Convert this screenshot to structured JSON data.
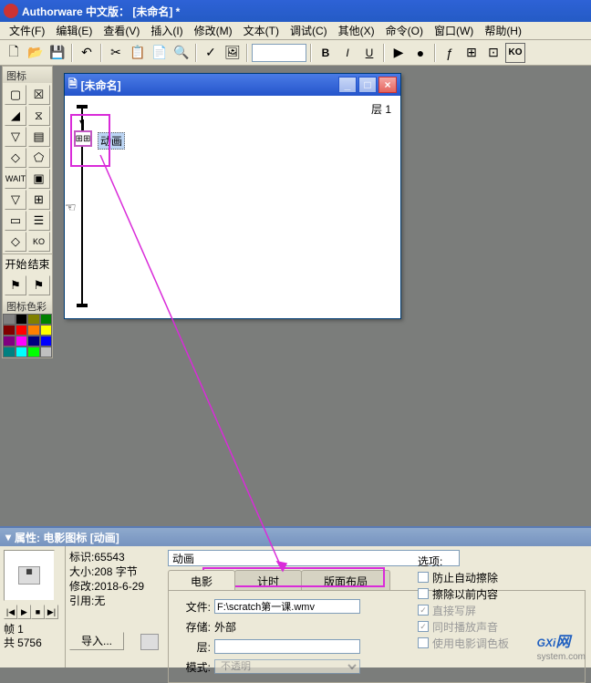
{
  "title": "Authorware 中文版： [未命名] *",
  "menus": [
    "文件(F)",
    "编辑(E)",
    "查看(V)",
    "插入(I)",
    "修改(M)",
    "文本(T)",
    "调试(C)",
    "其他(X)",
    "命令(O)",
    "窗口(W)",
    "帮助(H)"
  ],
  "palette": {
    "title": "图标",
    "section1": "开始",
    "section2": "结束",
    "colors_title": "图标色彩"
  },
  "flowwin": {
    "title": "[未命名]",
    "layer": "层 1",
    "movie_label": "动画"
  },
  "props": {
    "title": "属性: 电影图标 [动画]",
    "meta": {
      "id_label": "标识:",
      "id": "65543",
      "size_label": "大小:",
      "size": "208 字节",
      "mod_label": "修改:",
      "mod": "2018-6-29",
      "ref_label": "引用:",
      "ref": "无"
    },
    "frame": {
      "l1_label": "帧",
      "l1_val": "1",
      "l2_label": "共",
      "l2_val": "5756"
    },
    "import_label": "导入...",
    "name": "动画",
    "tabs": [
      "电影",
      "计时",
      "版面布局"
    ],
    "fields": {
      "file_label": "文件:",
      "file_val": "F:\\scratch第一课.wmv",
      "store_label": "存储:",
      "store_val": "外部",
      "layer_label": "层:",
      "mode_label": "模式:",
      "mode_val": "不透明"
    },
    "options": {
      "label": "选项:",
      "o1": "防止自动擦除",
      "o2": "擦除以前内容",
      "o3": "直接写屏",
      "o4": "同时播放声音",
      "o5": "使用电影调色板"
    }
  },
  "watermark": {
    "main": "GXi",
    "sub": "system.com",
    "cn": "网"
  },
  "colors": [
    "#808080",
    "#000000",
    "#808000",
    "#008000",
    "#800000",
    "#ff0000",
    "#ff8000",
    "#ffff00",
    "#800080",
    "#ff00ff",
    "#000080",
    "#0000ff",
    "#008080",
    "#00ffff",
    "#00ff00",
    "#c0c0c0"
  ]
}
